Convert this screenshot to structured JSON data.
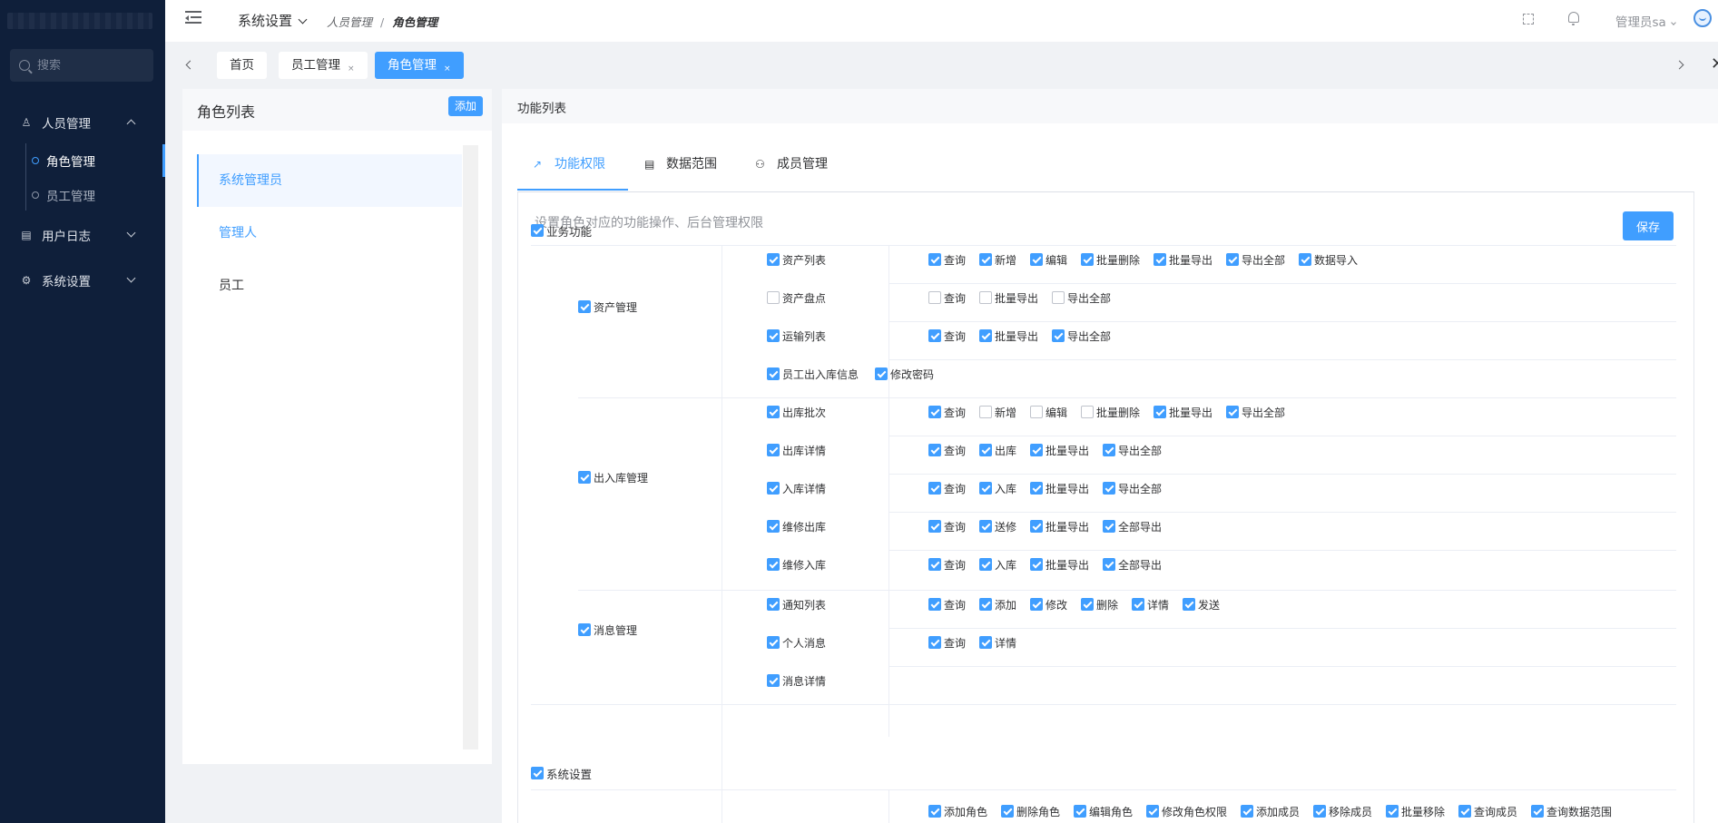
{
  "sidebar": {
    "search_placeholder": "搜索",
    "groups": [
      {
        "label": "人员管理",
        "icon": "user-icon"
      },
      {
        "label": "用户日志",
        "icon": "log-icon"
      },
      {
        "label": "系统设置",
        "icon": "gear-icon"
      }
    ],
    "sub_items": [
      "角色管理",
      "员工管理"
    ]
  },
  "header": {
    "title": "系统设置",
    "breadcrumb": [
      "人员管理",
      "角色管理"
    ],
    "user": "管理员sa"
  },
  "tabs": [
    {
      "label": "首页"
    },
    {
      "label": "员工管理"
    },
    {
      "label": "角色管理"
    }
  ],
  "left": {
    "title": "角色列表",
    "add_label": "添加",
    "roles": [
      "系统管理员",
      "管理人",
      "员工"
    ]
  },
  "right": {
    "title": "功能列表",
    "tabs": [
      {
        "label": "功能权限",
        "icon": "pencil-icon"
      },
      {
        "label": "数据范围",
        "icon": "book-icon"
      },
      {
        "label": "成员管理",
        "icon": "group-icon"
      }
    ],
    "description": "设置角色对应的功能操作、后台管理权限",
    "save_label": "保存"
  },
  "perm": {
    "business": {
      "label": "业务功能",
      "checked": true
    },
    "system": {
      "label": "系统设置",
      "checked": true
    },
    "groups": [
      {
        "label": "资产管理",
        "checked": true
      },
      {
        "label": "出入库管理",
        "checked": true
      },
      {
        "label": "消息管理",
        "checked": true
      }
    ],
    "rows": [
      {
        "label": "资产列表",
        "checked": true,
        "ops": [
          [
            "查询",
            true
          ],
          [
            "新增",
            true
          ],
          [
            "编辑",
            true
          ],
          [
            "批量删除",
            true
          ],
          [
            "批量导出",
            true
          ],
          [
            "导出全部",
            true
          ],
          [
            "数据导入",
            true
          ]
        ]
      },
      {
        "label": "资产盘点",
        "checked": false,
        "ops": [
          [
            "查询",
            false
          ],
          [
            "批量导出",
            false
          ],
          [
            "导出全部",
            false
          ]
        ]
      },
      {
        "label": "运输列表",
        "checked": true,
        "ops": [
          [
            "查询",
            true
          ],
          [
            "批量导出",
            true
          ],
          [
            "导出全部",
            true
          ]
        ]
      },
      {
        "label": "员工出入库信息",
        "checked": true,
        "extra": [
          "修改密码",
          true
        ],
        "ops": []
      },
      {
        "label": "出库批次",
        "checked": true,
        "ops": [
          [
            "查询",
            true
          ],
          [
            "新增",
            false
          ],
          [
            "编辑",
            false
          ],
          [
            "批量删除",
            false
          ],
          [
            "批量导出",
            true
          ],
          [
            "导出全部",
            true
          ]
        ]
      },
      {
        "label": "出库详情",
        "checked": true,
        "ops": [
          [
            "查询",
            true
          ],
          [
            "出库",
            true
          ],
          [
            "批量导出",
            true
          ],
          [
            "导出全部",
            true
          ]
        ]
      },
      {
        "label": "入库详情",
        "checked": true,
        "ops": [
          [
            "查询",
            true
          ],
          [
            "入库",
            true
          ],
          [
            "批量导出",
            true
          ],
          [
            "导出全部",
            true
          ]
        ]
      },
      {
        "label": "维修出库",
        "checked": true,
        "ops": [
          [
            "查询",
            true
          ],
          [
            "送修",
            true
          ],
          [
            "批量导出",
            true
          ],
          [
            "全部导出",
            true
          ]
        ]
      },
      {
        "label": "维修入库",
        "checked": true,
        "ops": [
          [
            "查询",
            true
          ],
          [
            "入库",
            true
          ],
          [
            "批量导出",
            true
          ],
          [
            "全部导出",
            true
          ]
        ]
      },
      {
        "label": "通知列表",
        "checked": true,
        "ops": [
          [
            "查询",
            true
          ],
          [
            "添加",
            true
          ],
          [
            "修改",
            true
          ],
          [
            "删除",
            true
          ],
          [
            "详情",
            true
          ],
          [
            "发送",
            true
          ]
        ]
      },
      {
        "label": "个人消息",
        "checked": true,
        "ops": [
          [
            "查询",
            true
          ],
          [
            "详情",
            true
          ]
        ]
      },
      {
        "label": "消息详情",
        "checked": true,
        "ops": []
      }
    ],
    "sys_ops": [
      [
        "添加角色",
        true
      ],
      [
        "删除角色",
        true
      ],
      [
        "编辑角色",
        true
      ],
      [
        "修改角色权限",
        true
      ],
      [
        "添加成员",
        true
      ],
      [
        "移除成员",
        true
      ],
      [
        "批量移除",
        true
      ],
      [
        "查询成员",
        true
      ],
      [
        "查询数据范围",
        true
      ]
    ]
  }
}
